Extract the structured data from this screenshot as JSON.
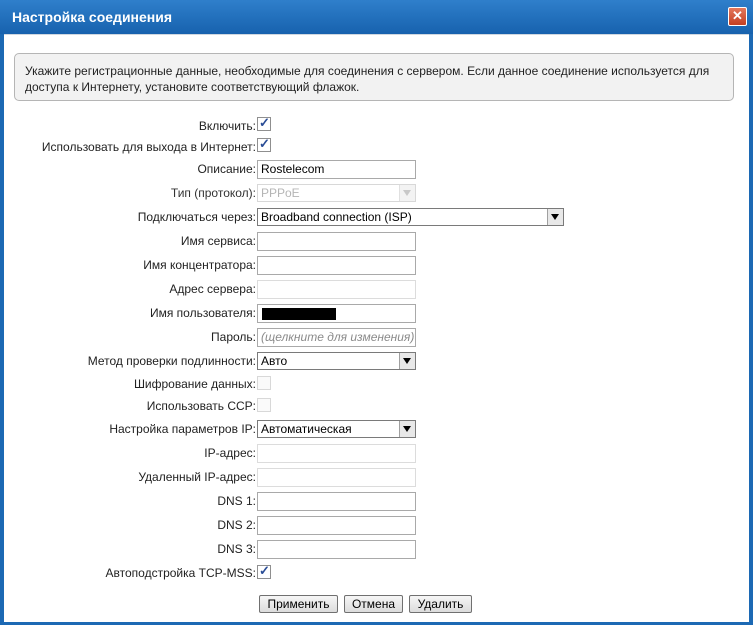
{
  "window": {
    "title": "Настройка соединения",
    "close_label": "✕"
  },
  "info_text": "Укажите регистрационные данные, необходимые для соединения с сервером. Если данное соединение используется для доступа к Интернету, установите соответствующий флажок.",
  "fields": {
    "enable": {
      "label": "Включить:",
      "checked": true
    },
    "use_internet": {
      "label": "Использовать для выхода в Интернет:",
      "checked": true
    },
    "description": {
      "label": "Описание:",
      "value": "Rostelecom"
    },
    "type": {
      "label": "Тип (протокол):",
      "value": "PPPoE"
    },
    "connect_via": {
      "label": "Подключаться через:",
      "value": "Broadband connection (ISP)"
    },
    "service_name": {
      "label": "Имя сервиса:",
      "value": ""
    },
    "concentrator_name": {
      "label": "Имя концентратора:",
      "value": ""
    },
    "server_address": {
      "label": "Адрес сервера:",
      "value": ""
    },
    "username": {
      "label": "Имя пользователя:",
      "value": ""
    },
    "password": {
      "label": "Пароль:",
      "placeholder": "(щелкните для изменения)"
    },
    "auth_method": {
      "label": "Метод проверки подлинности:",
      "value": "Авто"
    },
    "encryption": {
      "label": "Шифрование данных:",
      "checked": false
    },
    "use_ccp": {
      "label": "Использовать CCP:",
      "checked": false
    },
    "ip_settings": {
      "label": "Настройка параметров IP:",
      "value": "Автоматическая"
    },
    "ip_address": {
      "label": "IP-адрес:",
      "value": ""
    },
    "remote_ip": {
      "label": "Удаленный IP-адрес:",
      "value": ""
    },
    "dns1": {
      "label": "DNS 1:",
      "value": ""
    },
    "dns2": {
      "label": "DNS 2:",
      "value": ""
    },
    "dns3": {
      "label": "DNS 3:",
      "value": ""
    },
    "tcp_mss": {
      "label": "Автоподстройка TCP-MSS:",
      "checked": true
    }
  },
  "buttons": {
    "apply": "Применить",
    "cancel": "Отмена",
    "delete": "Удалить"
  },
  "colors": {
    "titlebar": "#1c69b4",
    "close_button": "#c94a2c",
    "checkmark": "#2a4d96"
  }
}
